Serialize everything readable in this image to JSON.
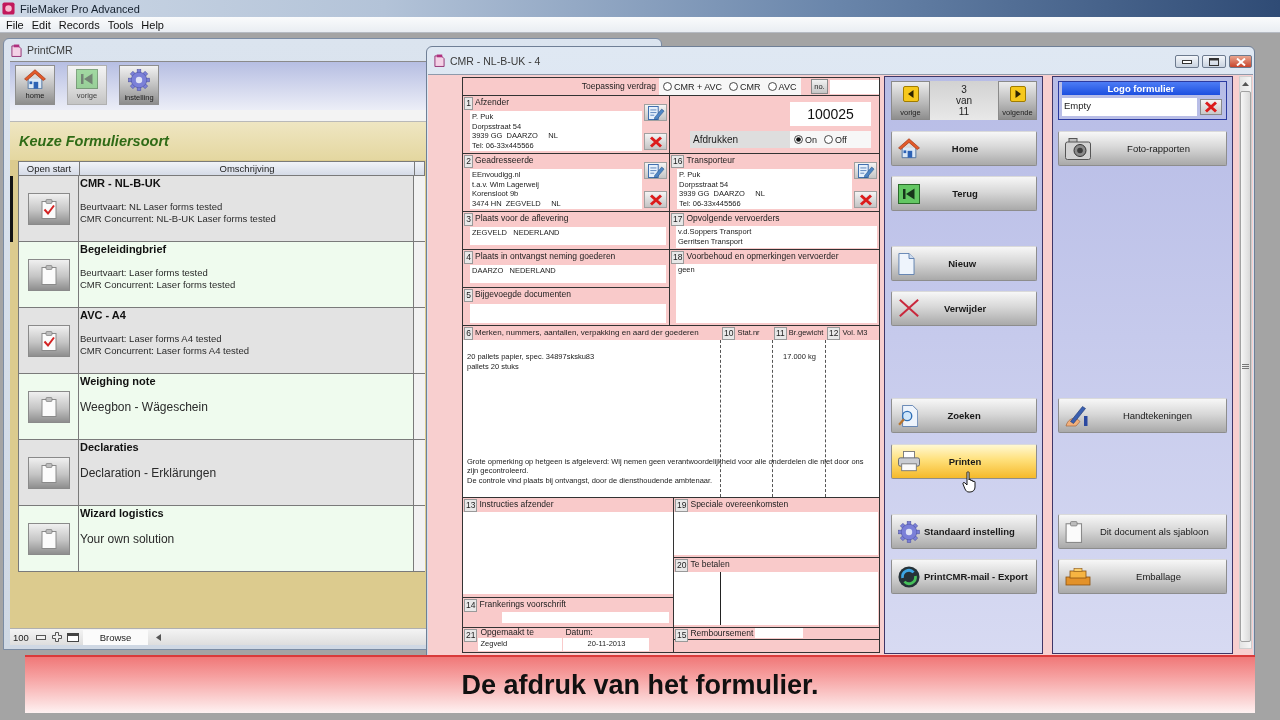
{
  "app": {
    "title": "FileMaker Pro Advanced",
    "menu": [
      "File",
      "Edit",
      "Records",
      "Tools",
      "Help"
    ]
  },
  "list_window": {
    "title": "PrintCMR",
    "toolbar": [
      {
        "kind": "home",
        "label": "home",
        "disabled": false
      },
      {
        "kind": "back",
        "label": "vorige",
        "disabled": true
      },
      {
        "kind": "gear",
        "label": "instelling",
        "disabled": false
      }
    ],
    "heading": "Keuze Formuliersoort",
    "columns": [
      "Open start",
      "Omschrijving"
    ],
    "rows": [
      {
        "title": "CMR - NL-B-UK",
        "kind": "notes",
        "lines": [
          "Beurtvaart: NL Laser forms tested",
          "CMR Concurrent: NL-B-UK Laser forms tested"
        ],
        "checked": true,
        "selected": true
      },
      {
        "title": "Begeleidingbrief",
        "kind": "notes",
        "lines": [
          "Beurtvaart: Laser forms tested",
          "CMR Concurrent: Laser forms tested"
        ],
        "checked": false,
        "selected": false
      },
      {
        "title": "AVC - A4",
        "kind": "notes",
        "lines": [
          "Beurtvaart: Laser forms A4 tested",
          "CMR Concurrent: Laser forms A4 tested"
        ],
        "checked": true,
        "selected": false
      },
      {
        "title": "Weighing note",
        "kind": "subtitle",
        "lines": [
          "Weegbon - Wägeschein"
        ],
        "checked": false,
        "selected": false
      },
      {
        "title": "Declaraties",
        "kind": "subtitle",
        "lines": [
          "Declaration - Erklärungen"
        ],
        "checked": false,
        "selected": false
      },
      {
        "title": "Wizard logistics",
        "kind": "subtitle",
        "lines": [
          "Your own solution"
        ],
        "checked": false,
        "selected": false
      }
    ],
    "status_bar": {
      "zoom": "100",
      "mode": "Browse"
    }
  },
  "form_window": {
    "title": "CMR - NL-B-UK - 4",
    "convention": {
      "label": "Toepassing verdrag",
      "options": [
        {
          "label": "CMR + AVC",
          "selected": false
        },
        {
          "label": "CMR",
          "selected": false
        },
        {
          "label": "AVC",
          "selected": false
        }
      ],
      "number_button": "no."
    },
    "document_number": "100025",
    "print": {
      "label": "Afdrukken",
      "options": [
        {
          "label": "On",
          "selected": true
        },
        {
          "label": "Off",
          "selected": false
        }
      ]
    },
    "sender": {
      "number": "1",
      "label": "Afzender",
      "lines": [
        "P. Puk",
        "Dorpsstraat 54",
        "3939 GG  DAARZO     NL",
        "Tel: 06-33x445566"
      ]
    },
    "consignee": {
      "number": "2",
      "label": "Geadresseerde",
      "lines": [
        "EEnvoudigg.nl",
        "t.a.v. Wim Lagerweij",
        "Korensloot 9b",
        "3474 HN  ZEGVELD     NL"
      ]
    },
    "carrier": {
      "number": "16",
      "label": "Transporteur",
      "lines": [
        "P. Puk",
        "Dorpsstraat 54",
        "3939 GG  DAARZO     NL",
        "Tel: 06-33x445566"
      ]
    },
    "delivery_place": {
      "number": "3",
      "label": "Plaats voor de aflevering",
      "lines": [
        "ZEGVELD   NEDERLAND"
      ]
    },
    "successive_carriers": {
      "number": "17",
      "label": "Opvolgende vervoerders",
      "lines": [
        "v.d.Soppers Transport",
        "Gerritsen Transport"
      ]
    },
    "takeover_place": {
      "number": "4",
      "label": "Plaats in ontvangst neming goederen",
      "lines": [
        "DAARZO   NEDERLAND"
      ]
    },
    "carrier_remarks": {
      "number": "18",
      "label": "Voorbehoud en opmerkingen vervoerder",
      "lines": [
        "geen"
      ]
    },
    "documents": {
      "number": "5",
      "label": "Bijgevoegde documenten"
    },
    "goods": {
      "columns": [
        {
          "number": "6",
          "label": "Merken, nummers, aantallen, verpakking en aard der goederen"
        },
        {
          "number": "10",
          "label": "Stat.nr"
        },
        {
          "number": "11",
          "label": "Br.gewicht"
        },
        {
          "number": "12",
          "label": "Vol. M3"
        }
      ],
      "description": [
        "20 pallets papier, spec. 34897sksku83",
        "pallets 20 stuks"
      ],
      "weight": "17.000 kg",
      "remark": [
        "Grote opmerking op hetgeen is afgeleverd: Wij nemen geen verantwoordelijkheid voor alle onderdelen die niet door ons zijn gecontroleerd.",
        "De controle vind plaats bij ontvangst, door de diensthoudende ambtenaar."
      ]
    },
    "instructions": {
      "number": "13",
      "label": "Instructies afzender"
    },
    "agreements": {
      "number": "19",
      "label": "Speciale overeenkomsten"
    },
    "payment": {
      "number": "20",
      "label": "Te betalen"
    },
    "franking": {
      "number": "14",
      "label": "Frankerings voorschrift"
    },
    "issued": {
      "number": "21",
      "label": "Opgemaakt te",
      "date_label": "Datum:",
      "place": "Zegveld",
      "date": "20-11-2013"
    },
    "cash_on_delivery": {
      "number": "15",
      "label": "Remboursement"
    },
    "record_nav": {
      "previous": "vorige",
      "next": "volgende",
      "current": "3",
      "separator": "van",
      "total": "11"
    },
    "logo": {
      "label": "Logo formulier",
      "value": "Empty"
    },
    "action_rows": [
      {
        "left": {
          "kind": "home",
          "label": "Home",
          "hovered": false
        },
        "right": {
          "kind": "camera",
          "label": "Foto-rapporten",
          "hovered": false
        }
      },
      {
        "left": {
          "kind": "back",
          "label": "Terug",
          "hovered": false
        }
      },
      {
        "left": {
          "kind": "new",
          "label": "Nieuw",
          "hovered": false
        }
      },
      {
        "left": {
          "kind": "delete",
          "label": "Verwijder",
          "hovered": false
        }
      },
      {
        "left": {
          "kind": "search",
          "label": "Zoeken",
          "hovered": false
        },
        "right": {
          "kind": "signature",
          "label": "Handtekeningen",
          "hovered": false
        }
      },
      {
        "left": {
          "kind": "print",
          "label": "Printen",
          "hovered": true
        }
      },
      {
        "left": {
          "kind": "gear",
          "label": "Standaard instelling",
          "hovered": false
        },
        "right": {
          "kind": "template",
          "label": "Dit document als sjabloon",
          "hovered": false
        }
      },
      {
        "left": {
          "kind": "export",
          "label": "PrintCMR-mail - Export",
          "hovered": false
        },
        "right": {
          "kind": "packaging",
          "label": "Emballage",
          "hovered": false
        }
      }
    ]
  },
  "caption": "De afdruk van het formulier."
}
